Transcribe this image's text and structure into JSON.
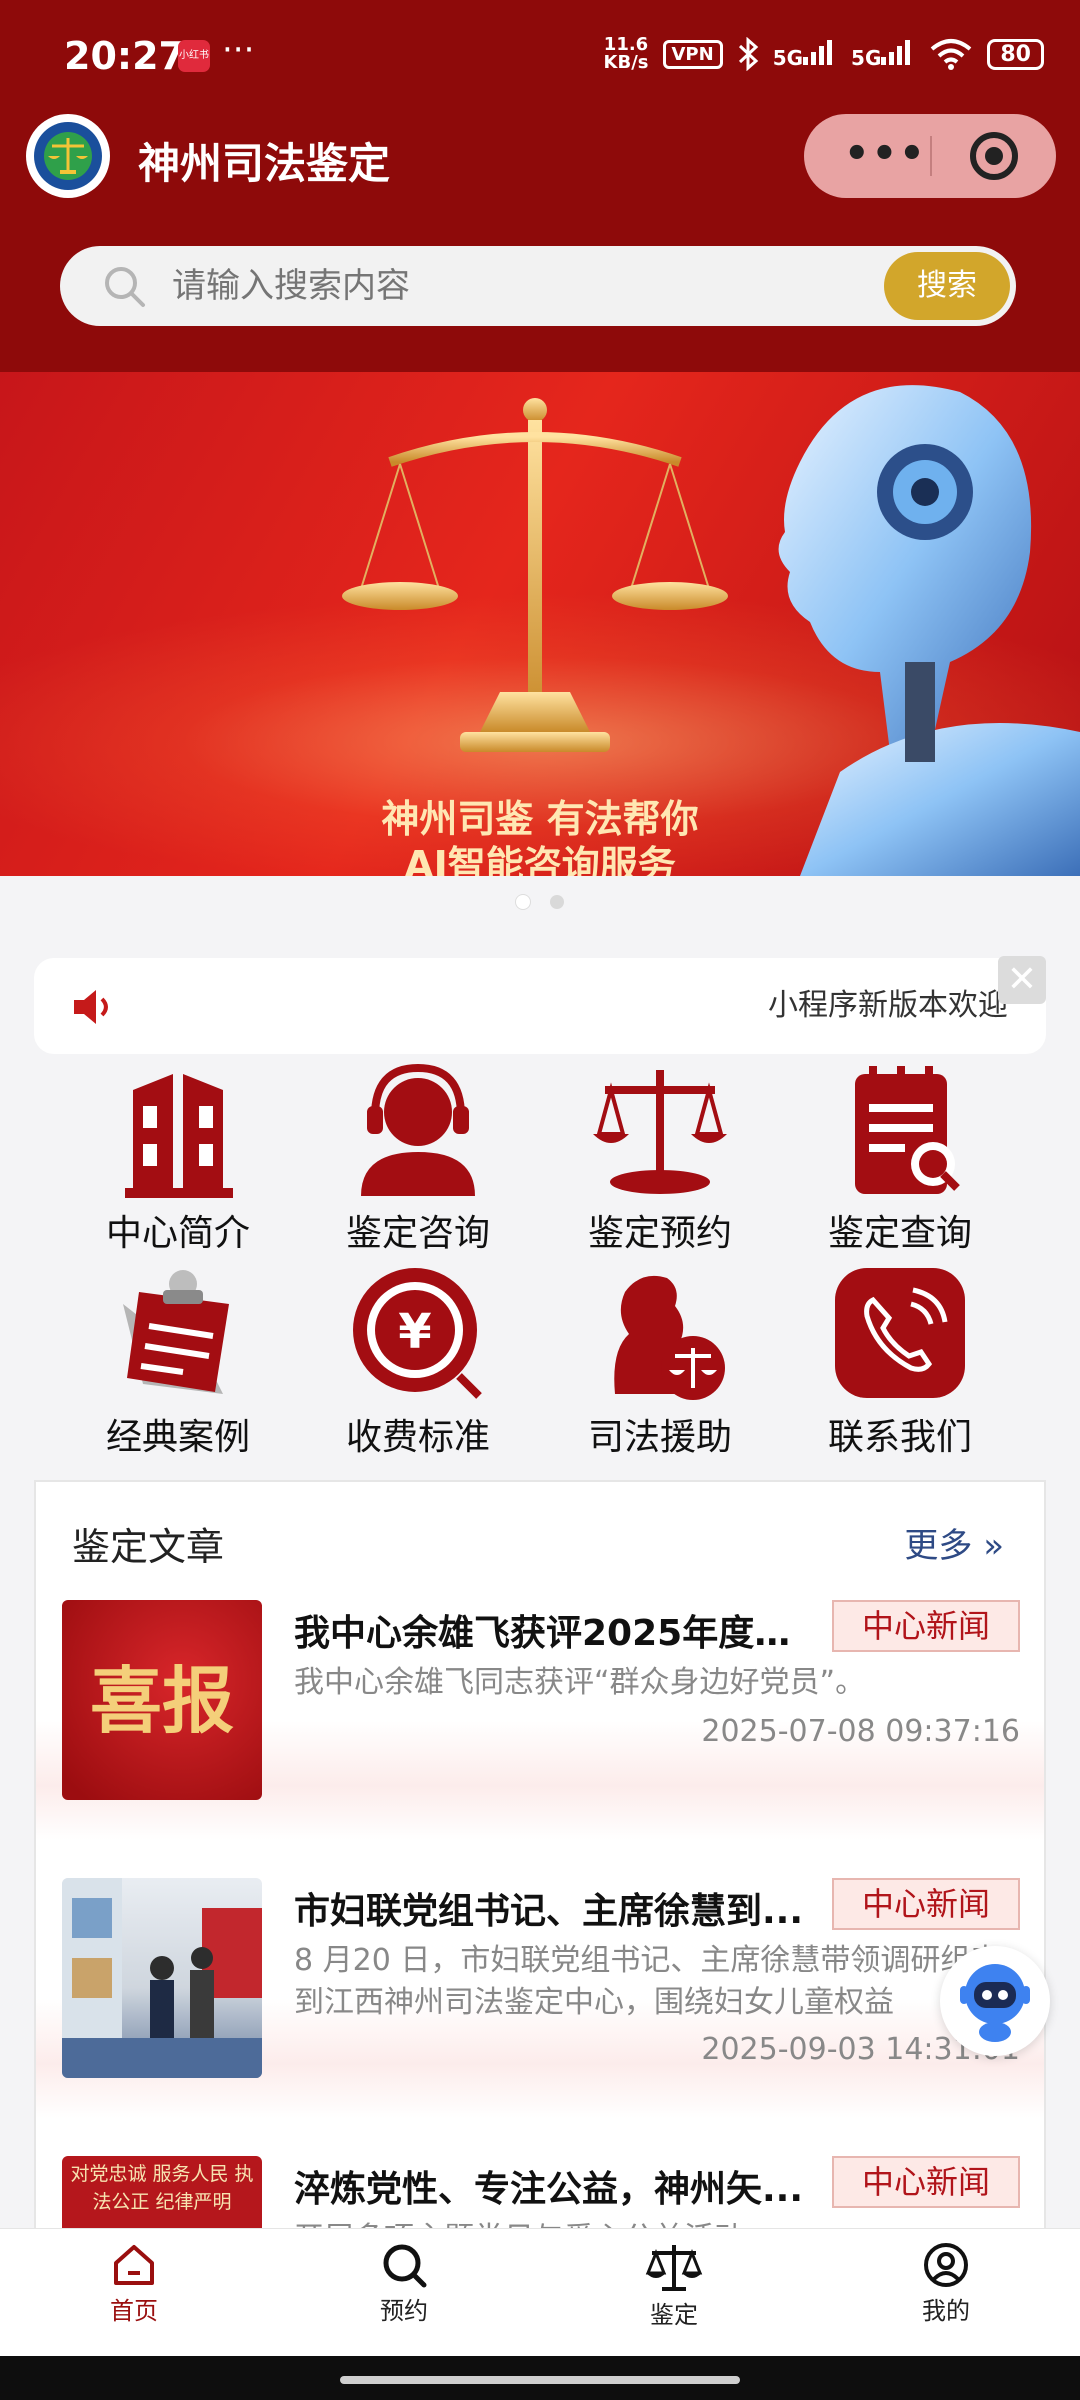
{
  "status_bar": {
    "time": "20:27",
    "notif_app": "小红书",
    "dots": "···",
    "speed_top": "11.6",
    "speed_bottom": "KB/s",
    "vpn": "VPN",
    "signal1": "5G",
    "signal2": "5G",
    "battery": "80"
  },
  "header": {
    "title": "神州司法鉴定",
    "capsule_more": "•••"
  },
  "search": {
    "placeholder": "请输入搜索内容",
    "button": "搜索"
  },
  "banner": {
    "line1": "神州司鉴 有法帮你",
    "line2": "AI智能咨询服务",
    "slides": 2,
    "active_slide": 1
  },
  "notice": {
    "text": "小程序新版本欢迎",
    "close": "✕"
  },
  "grid": [
    {
      "label": "中心简介",
      "icon": "building-icon"
    },
    {
      "label": "鉴定咨询",
      "icon": "headset-person-icon"
    },
    {
      "label": "鉴定预约",
      "icon": "scale-icon"
    },
    {
      "label": "鉴定查询",
      "icon": "document-search-icon"
    },
    {
      "label": "经典案例",
      "icon": "clipboard-icon"
    },
    {
      "label": "收费标准",
      "icon": "yuan-search-icon"
    },
    {
      "label": "司法援助",
      "icon": "judge-scale-icon"
    },
    {
      "label": "联系我们",
      "icon": "phone-icon"
    }
  ],
  "articles": {
    "section_title": "鉴定文章",
    "more": "更多",
    "more_arrow": "»",
    "items": [
      {
        "title": "我中心余雄飞获评2025年度“...",
        "tag": "中心新闻",
        "summary": "我中心余雄飞同志获评“群众身边好党员”。",
        "date": "2025-07-08 09:37:16",
        "thumb_text": "喜报"
      },
      {
        "title": "市妇联党组书记、主席徐慧到...",
        "tag": "中心新闻",
        "summary": "8 月20 日，市妇联党组书记、主席徐慧带领调研组来到江西神州司法鉴定中心，围绕妇女儿童权益",
        "date": "2025-09-03 14:31:01"
      },
      {
        "title": "淬炼党性、专注公益，神州矢...",
        "tag": "中心新闻",
        "summary": "开展多项主题党日与爱心公益活动",
        "thumb_text": "对党忠诚 服务人民 执法公正 纪律严明"
      }
    ]
  },
  "tabbar": [
    {
      "label": "首页",
      "icon": "home-icon",
      "active": true
    },
    {
      "label": "预约",
      "icon": "search-icon",
      "active": false
    },
    {
      "label": "鉴定",
      "icon": "scale-icon",
      "active": false
    },
    {
      "label": "我的",
      "icon": "user-icon",
      "active": false
    }
  ],
  "colors": {
    "brand": "#8e0a0a",
    "accent": "#d2a62b",
    "tag_text": "#b1141a",
    "more_link": "#2e4a85"
  }
}
